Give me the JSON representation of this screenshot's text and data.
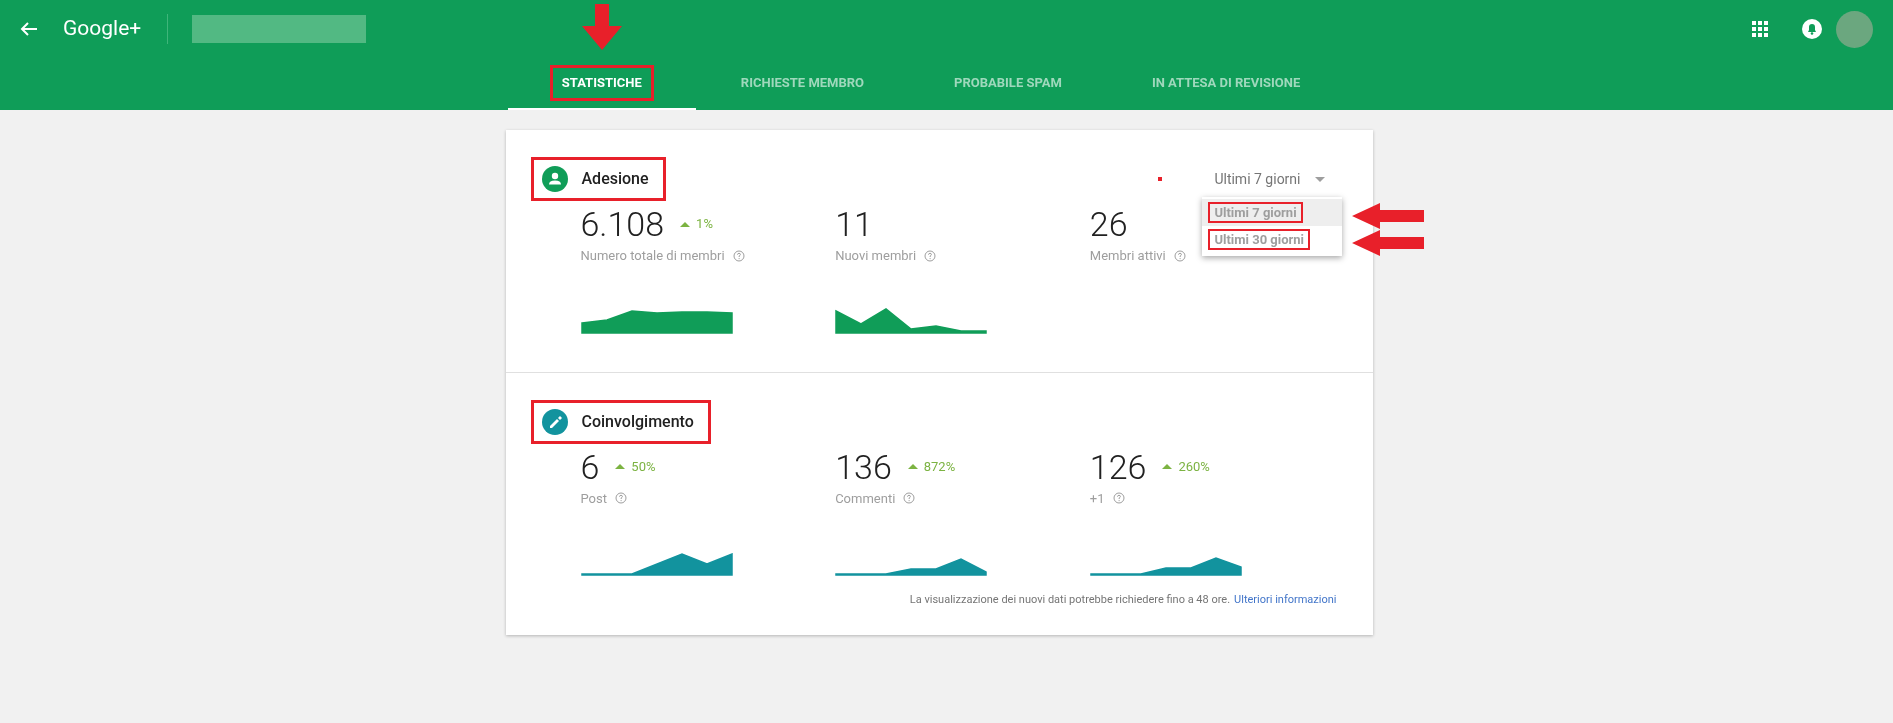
{
  "header": {
    "logo": "Google+"
  },
  "tabs": [
    {
      "label": "STATISTICHE",
      "selected": true,
      "annotated": true
    },
    {
      "label": "RICHIESTE MEMBRO",
      "selected": false,
      "annotated": false
    },
    {
      "label": "PROBABILE SPAM",
      "selected": false,
      "annotated": false
    },
    {
      "label": "IN ATTESA DI REVISIONE",
      "selected": false,
      "annotated": false
    }
  ],
  "range_select": {
    "value": "Ultimi 7 giorni",
    "expanded": true,
    "options": [
      {
        "label": "Ultimi 7 giorni",
        "selected": true,
        "annotated": true
      },
      {
        "label": "Ultimi 30 giorni",
        "selected": false,
        "annotated": true
      }
    ]
  },
  "sections": [
    {
      "title": "Adesione",
      "kind": "person",
      "color": "#109d58",
      "annotated": true,
      "metrics": [
        {
          "value": "6.108",
          "change": "1%",
          "label": "Numero totale di membri"
        },
        {
          "value": "11",
          "label": "Nuovi membri"
        },
        {
          "value": "26",
          "label": "Membri attivi"
        }
      ]
    },
    {
      "title": "Coinvolgimento",
      "kind": "pencil",
      "color": "#12939e",
      "annotated": true,
      "metrics": [
        {
          "value": "6",
          "change": "50%",
          "label": "Post"
        },
        {
          "value": "136",
          "change": "872%",
          "label": "Commenti"
        },
        {
          "value": "126",
          "change": "260%",
          "label": "+1"
        }
      ]
    }
  ],
  "footer": {
    "note": "La visualizzazione dei nuovi dati potrebbe richiedere fino a 48 ore.",
    "link": "Ulteriori informazioni"
  }
}
